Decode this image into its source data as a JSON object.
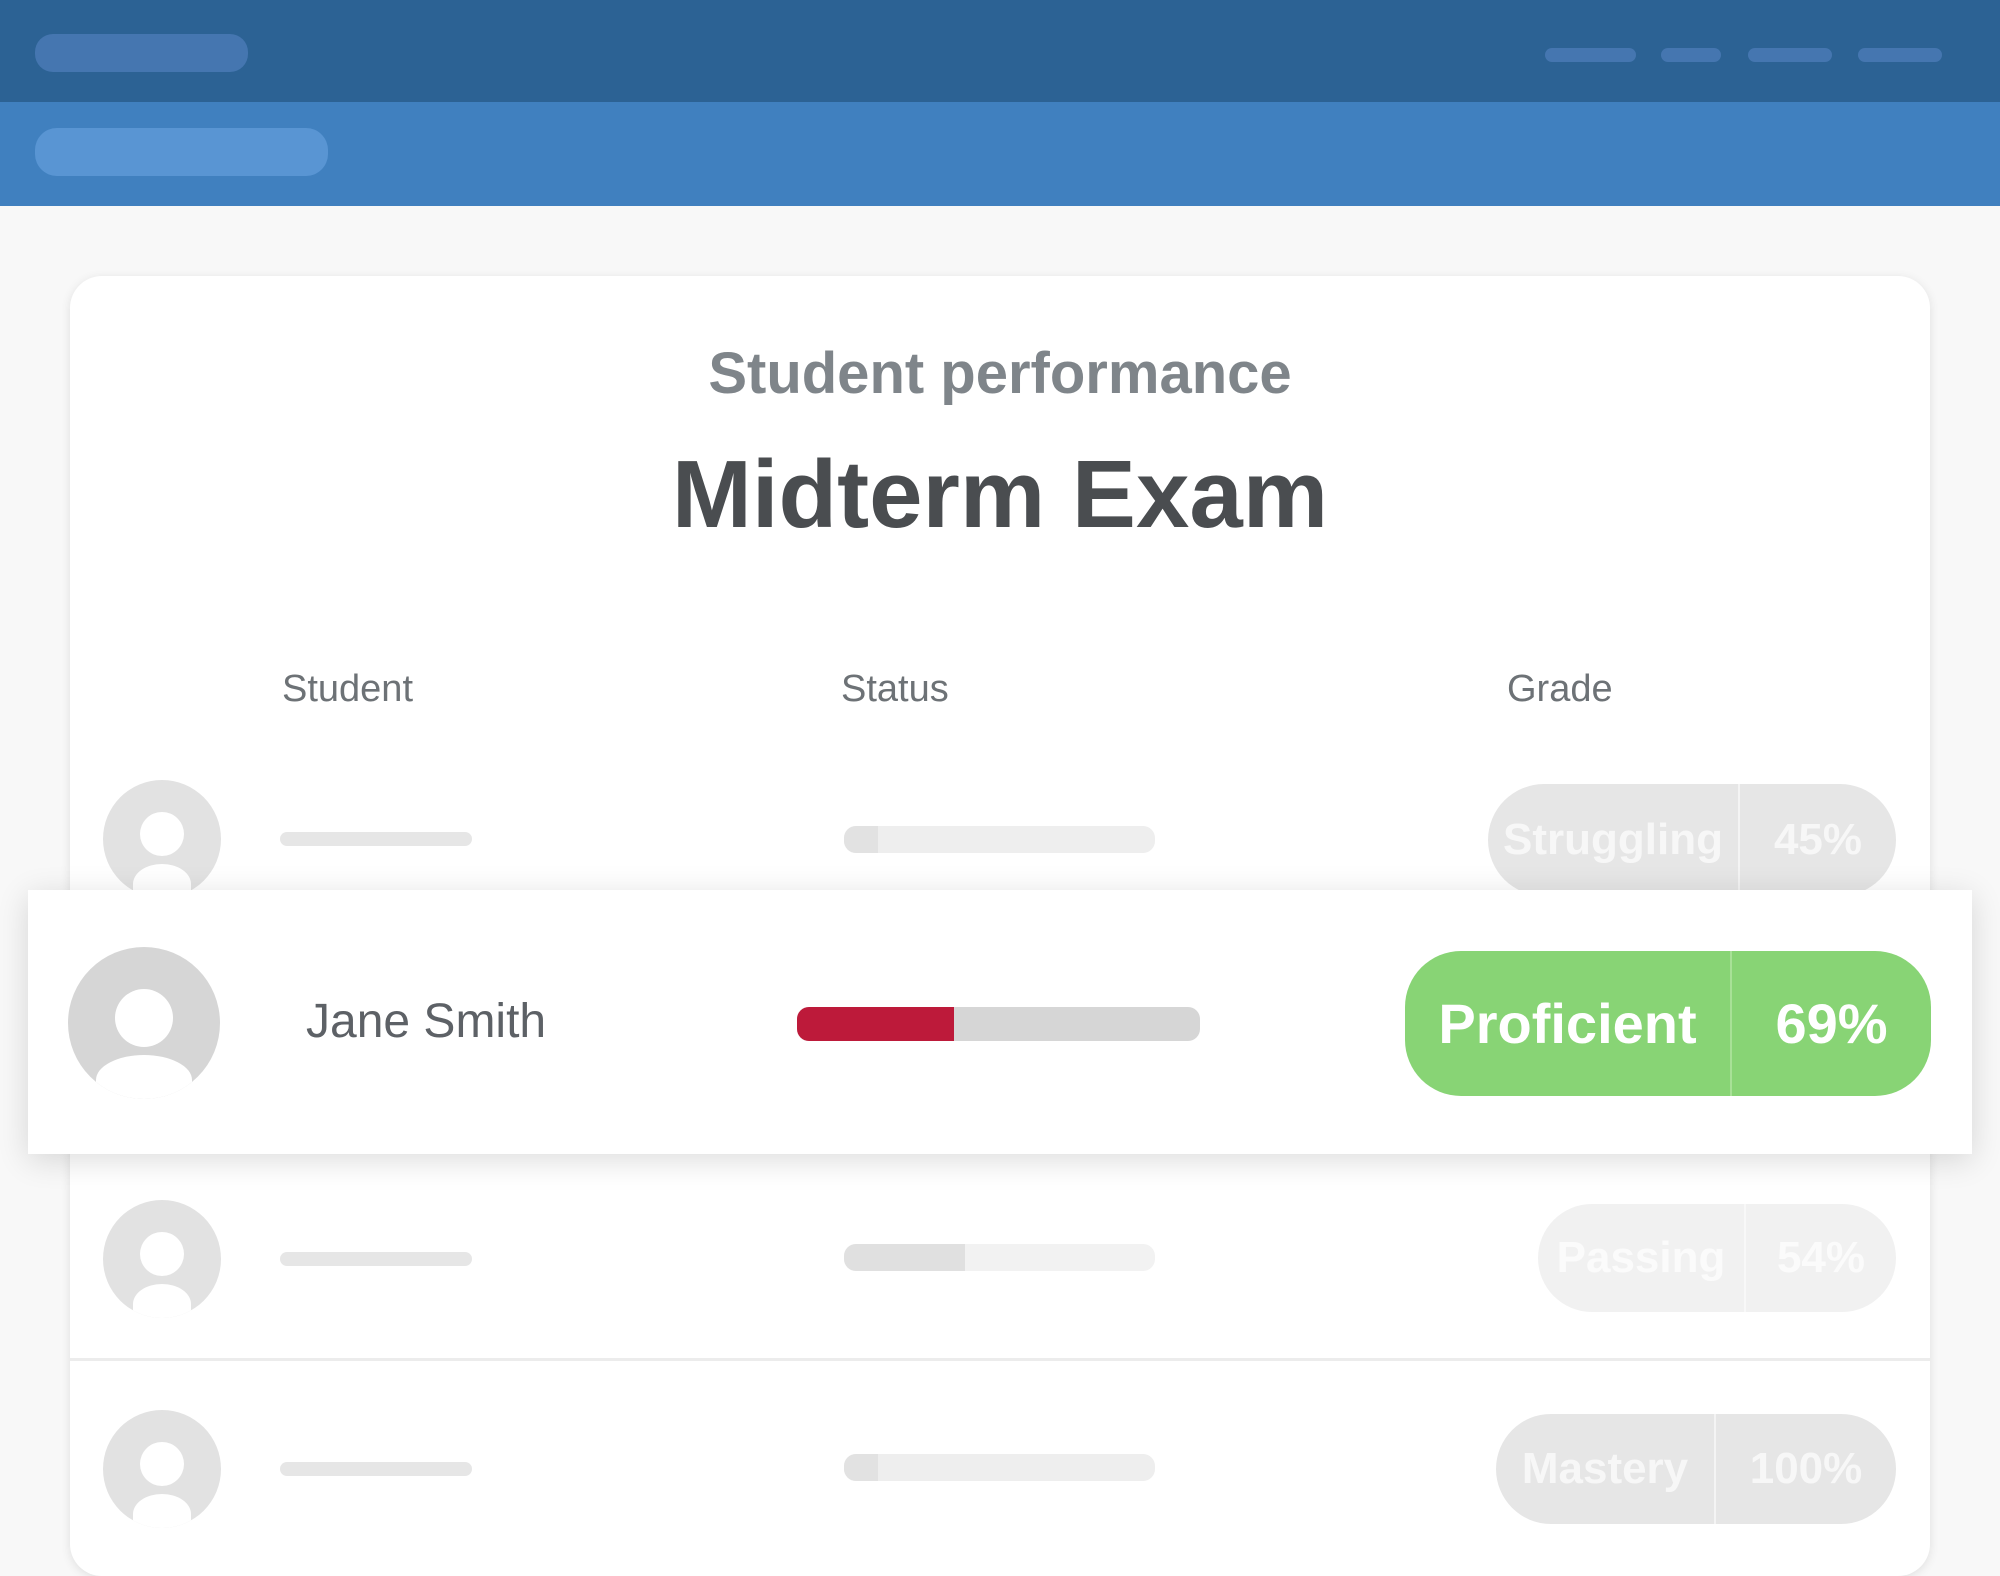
{
  "header": {
    "logo_placeholder": "app-logo",
    "nav_items": [
      "nav-1",
      "nav-2",
      "nav-3",
      "nav-4"
    ],
    "breadcrumb_placeholder": "breadcrumb"
  },
  "report": {
    "subtitle": "Student performance",
    "title": "Midterm Exam"
  },
  "columns": {
    "student": "Student",
    "status": "Status",
    "grade": "Grade"
  },
  "rows": [
    {
      "student": "",
      "progress": 0.11,
      "grade_label": "Struggling",
      "grade_percent": "45%",
      "color": "#e0e0e0",
      "faded": true
    },
    {
      "student": "Jane Smith",
      "progress": 0.39,
      "grade_label": "Proficient",
      "grade_percent": "69%",
      "color": "#88d475",
      "bar_color": "#bd1a3a",
      "faded": false
    },
    {
      "student": "",
      "progress": 0.39,
      "grade_label": "Passing",
      "grade_percent": "54%",
      "color": "#f1f1f1",
      "faded": true
    },
    {
      "student": "",
      "progress": 0.11,
      "grade_label": "Mastery",
      "grade_percent": "100%",
      "color": "#e6e6e6",
      "faded": true
    }
  ],
  "colors": {
    "topbar": "#2c6294",
    "subbar": "#4080bf",
    "proficient": "#88d475",
    "danger": "#bd1a3a"
  }
}
